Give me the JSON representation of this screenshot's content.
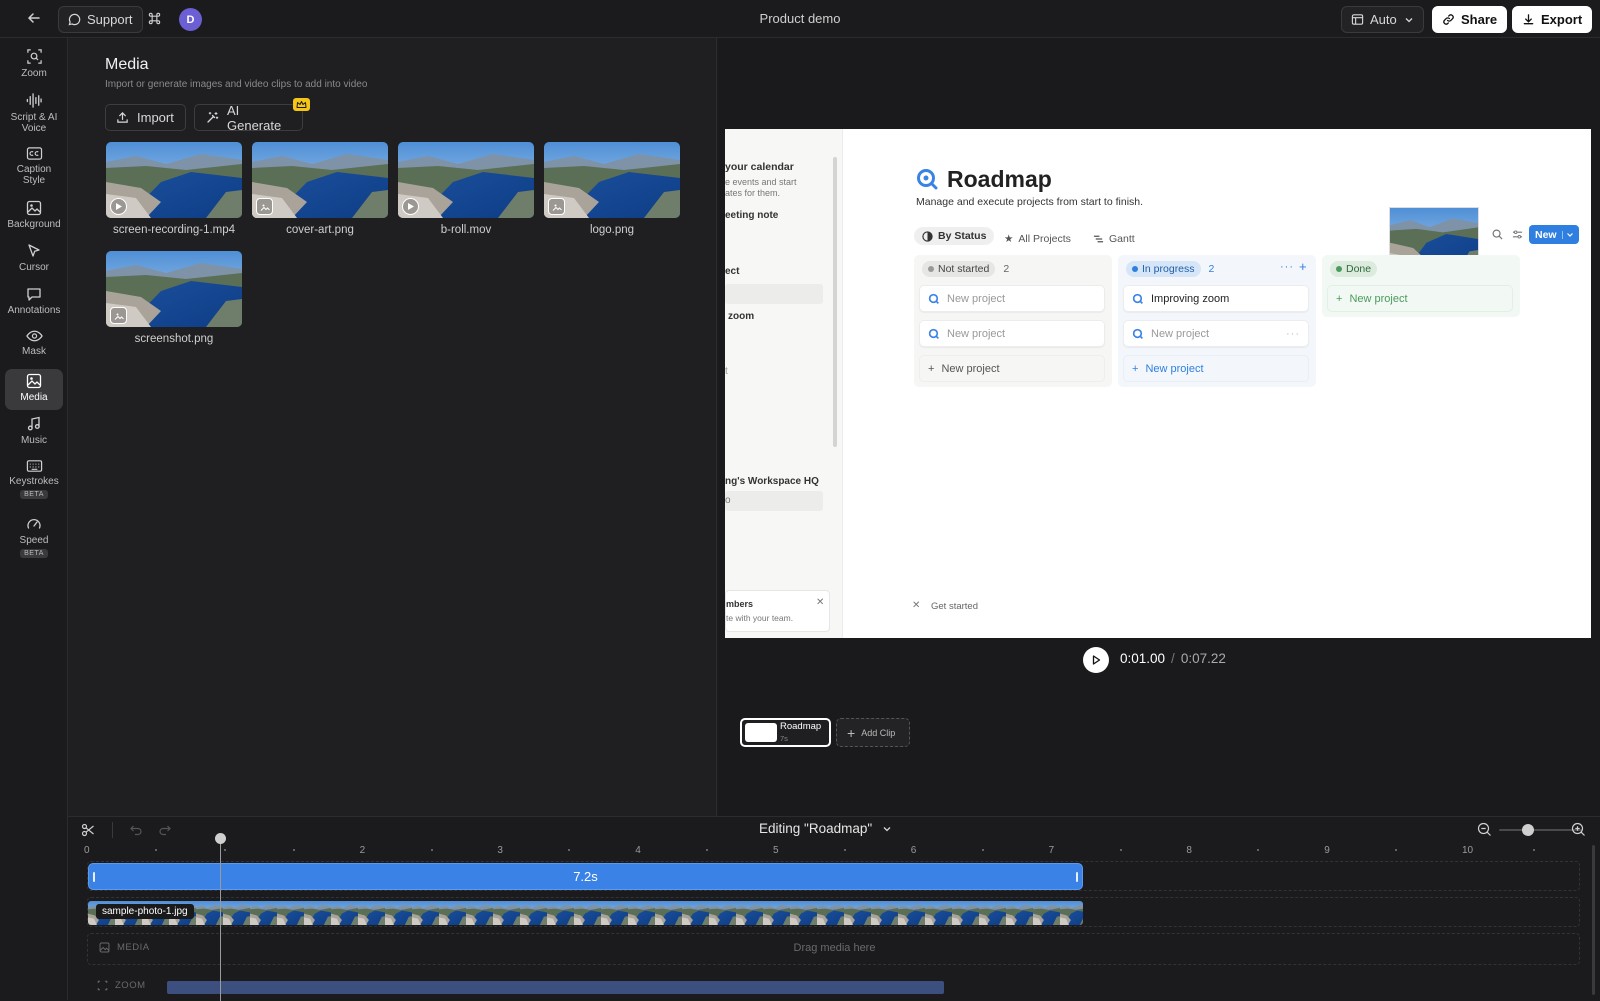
{
  "topbar": {
    "support_label": "Support",
    "avatar_initial": "D",
    "doc_title": "Product demo",
    "auto_label": "Auto",
    "share_label": "Share",
    "export_label": "Export"
  },
  "sidebar": {
    "items": [
      {
        "label": "Zoom",
        "icon": "zoom-icon"
      },
      {
        "label": "Script & AI Voice",
        "icon": "waveform-icon"
      },
      {
        "label": "Caption Style",
        "icon": "caption-icon"
      },
      {
        "label": "Background",
        "icon": "image-icon"
      },
      {
        "label": "Cursor",
        "icon": "cursor-icon"
      },
      {
        "label": "Annotations",
        "icon": "comment-icon"
      },
      {
        "label": "Mask",
        "icon": "eye-icon"
      },
      {
        "label": "Media",
        "icon": "media-icon",
        "active": true
      },
      {
        "label": "Music",
        "icon": "music-icon"
      },
      {
        "label": "Keystrokes",
        "icon": "keyboard-icon",
        "badge": "BETA"
      },
      {
        "label": "Speed",
        "icon": "gauge-icon",
        "badge": "BETA"
      }
    ]
  },
  "media": {
    "title": "Media",
    "subtitle": "Import or generate images and video clips to add into video",
    "import_label": "Import",
    "ai_generate_label": "AI Generate",
    "files": [
      {
        "name": "screen-recording-1.mp4",
        "kind": "video"
      },
      {
        "name": "cover-art.png",
        "kind": "image"
      },
      {
        "name": "b-roll.mov",
        "kind": "video"
      },
      {
        "name": "logo.png",
        "kind": "image"
      },
      {
        "name": "screenshot.png",
        "kind": "image"
      }
    ]
  },
  "preview": {
    "sidebar_texts": [
      "your calendar",
      "e events and start",
      "ates for them.",
      "eeting note",
      "ect",
      "zoom",
      "t",
      "ng's Workspace HQ",
      "o",
      "mbers",
      "te with your team."
    ],
    "page_title": "Roadmap",
    "page_subtitle": "Manage and execute projects from start to finish.",
    "views": [
      "By Status",
      "All Projects",
      "Gantt"
    ],
    "new_button": "New",
    "columns": [
      {
        "status": "Not started",
        "count": "2",
        "cards": [
          "New project",
          "New project"
        ],
        "add": "New project"
      },
      {
        "status": "In progress",
        "count": "2",
        "cards": [
          "Improving zoom",
          "New project"
        ],
        "add": "New project"
      },
      {
        "status": "Done",
        "count": "",
        "cards": [],
        "add": "New project"
      }
    ],
    "get_started": "Get started"
  },
  "player": {
    "current_time": "0:01.00",
    "separator": "/",
    "total_time": "0:07.22"
  },
  "clips": {
    "clip_name": "Roadmap",
    "clip_duration": "7s",
    "add_clip_label": "Add Clip"
  },
  "timeline": {
    "editing_label": "Editing \"Roadmap\"",
    "ticks": [
      "0",
      "2",
      "3",
      "4",
      "5",
      "6",
      "7",
      "8",
      "9",
      "10"
    ],
    "clip_duration_label": "7.2s",
    "media_clip_label": "sample-photo-1.jpg",
    "media_track_label": "MEDIA",
    "drag_hint": "Drag media here",
    "zoom_track_label": "ZOOM",
    "zoom_level": 0.35
  },
  "colors": {
    "accent_blue": "#3b82e6",
    "crown_yellow": "#f5c518",
    "avatar_purple": "#6b5fd3"
  }
}
